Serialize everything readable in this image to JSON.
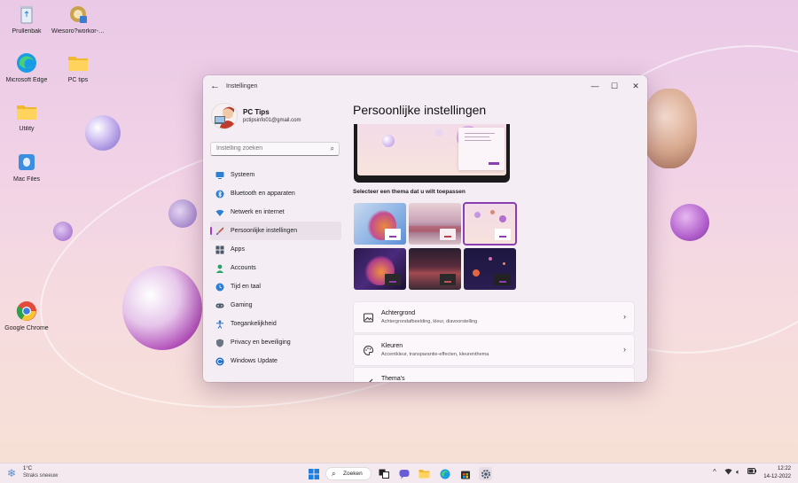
{
  "desktop": {
    "icons": [
      {
        "label": "Prullenbak",
        "icon": "recycle-bin-icon"
      },
      {
        "label": "Wiesoro?workor-1...",
        "icon": "app-icon"
      },
      {
        "label": "Microsoft Edge",
        "icon": "edge-icon"
      },
      {
        "label": "PC tips",
        "icon": "folder-icon"
      },
      {
        "label": "Utility",
        "icon": "folder-icon"
      },
      {
        "label": "Mac Files",
        "icon": "mac-files-icon"
      },
      {
        "label": "Google Chrome",
        "icon": "chrome-icon"
      }
    ]
  },
  "window": {
    "title": "Instellingen",
    "profile": {
      "name": "PC Tips",
      "email": "pctipsinfo01@gmail.com"
    },
    "search_placeholder": "Instelling zoeken",
    "nav": [
      {
        "label": "Systeem",
        "icon": "monitor-icon"
      },
      {
        "label": "Bluetooth en apparaten",
        "icon": "bluetooth-icon"
      },
      {
        "label": "Netwerk en internet",
        "icon": "network-icon"
      },
      {
        "label": "Persoonlijke instellingen",
        "icon": "brush-icon",
        "active": true
      },
      {
        "label": "Apps",
        "icon": "apps-icon"
      },
      {
        "label": "Accounts",
        "icon": "person-icon"
      },
      {
        "label": "Tijd en taal",
        "icon": "globe-clock-icon"
      },
      {
        "label": "Gaming",
        "icon": "gamepad-icon"
      },
      {
        "label": "Toegankelijkheid",
        "icon": "accessibility-icon"
      },
      {
        "label": "Privacy en beveiliging",
        "icon": "shield-icon"
      },
      {
        "label": "Windows Update",
        "icon": "update-icon"
      }
    ],
    "page_title": "Persoonlijke instellingen",
    "theme_label": "Selecteer een thema dat u wilt toepassen",
    "selected_theme_index": 2,
    "cards": [
      {
        "title": "Achtergrond",
        "subtitle": "Achtergrondafbeelding, kleur, diavoorstelling",
        "icon": "image-icon"
      },
      {
        "title": "Kleuren",
        "subtitle": "Accentkleur, transparantie-effecten, kleurenthema",
        "icon": "palette-icon"
      },
      {
        "title": "Thema's",
        "subtitle": "",
        "icon": "brush-icon"
      }
    ],
    "accent_color": "#8a3fb0"
  },
  "taskbar": {
    "weather_temp": "1°C",
    "weather_desc": "Straks sneeuw",
    "search_label": "Zoeken",
    "clock_time": "12:22",
    "clock_date": "14-12-2022"
  }
}
